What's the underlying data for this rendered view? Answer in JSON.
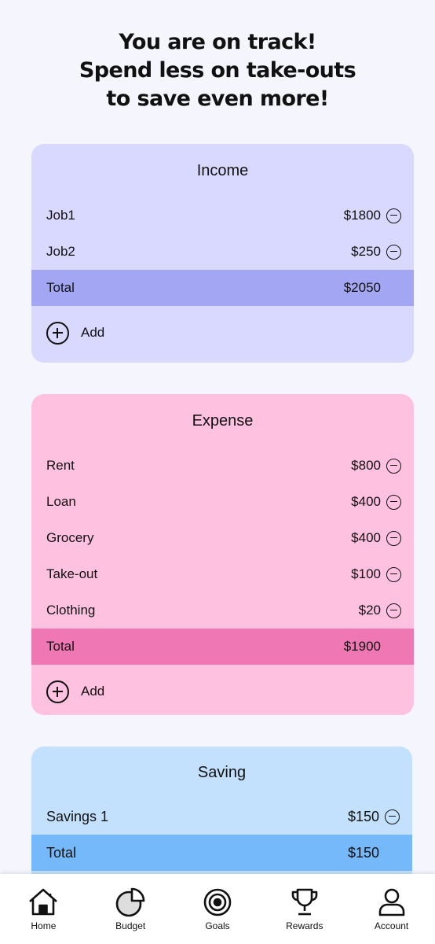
{
  "headline": {
    "line1": "You are on track!",
    "line2": "Spend less on take-outs",
    "line3": "to save even more!"
  },
  "income": {
    "title": "Income",
    "items": [
      {
        "name": "Job1",
        "amount": "$1800"
      },
      {
        "name": "Job2",
        "amount": "$250"
      }
    ],
    "total_label": "Total",
    "total_amount": "$2050",
    "add_label": "Add"
  },
  "expense": {
    "title": "Expense",
    "items": [
      {
        "name": "Rent",
        "amount": "$800"
      },
      {
        "name": "Loan",
        "amount": "$400"
      },
      {
        "name": "Grocery",
        "amount": "$400"
      },
      {
        "name": "Take-out",
        "amount": "$100"
      },
      {
        "name": "Clothing",
        "amount": "$20"
      }
    ],
    "total_label": "Total",
    "total_amount": "$1900",
    "add_label": "Add"
  },
  "saving": {
    "title": "Saving",
    "items": [
      {
        "name": "Savings 1",
        "amount": "$150"
      }
    ],
    "total_label": "Total",
    "total_amount": "$150"
  },
  "nav": {
    "items": [
      {
        "label": "Home",
        "icon": "home-icon"
      },
      {
        "label": "Budget",
        "icon": "pie-chart-icon"
      },
      {
        "label": "Goals",
        "icon": "target-icon"
      },
      {
        "label": "Rewards",
        "icon": "trophy-icon"
      },
      {
        "label": "Account",
        "icon": "user-icon"
      }
    ]
  },
  "colors": {
    "background": "#f5f5fe",
    "income_card": "#d9d8ff",
    "income_total": "#a3a6f3",
    "expense_card": "#fec1e0",
    "expense_total": "#ef78b4",
    "saving_card": "#c3e1fd",
    "saving_total": "#75b9fb"
  }
}
